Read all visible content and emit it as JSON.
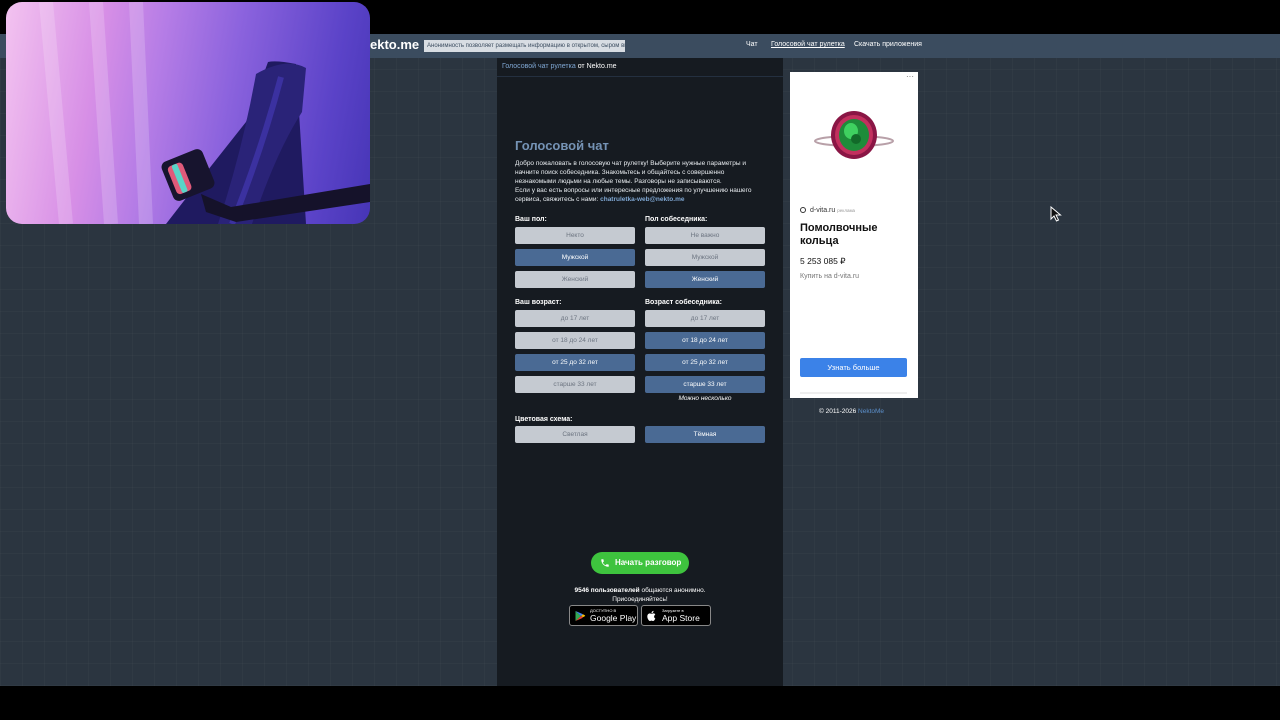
{
  "header": {
    "logo": "ekto.me",
    "notice": "Анонимность позволяет размещать информацию в открытом, сыром виде!",
    "nav": [
      {
        "label": "Чат",
        "active": false
      },
      {
        "label": "Голосовой чат рулетка",
        "active": true
      },
      {
        "label": "Скачать приложения",
        "active": false
      }
    ]
  },
  "breadcrumb": {
    "link": "Голосовой чат рулетка",
    "suffix": " от Nekto.me"
  },
  "main": {
    "title": "Голосовой чат",
    "intro_lines": [
      "Добро пожаловать в голосовую чат рулетку! Выберите нужные параметры и",
      "начните поиск собеседника. Знакомьтесь и общайтесь с совершенно",
      "незнакомыми людьми на любые темы. Разговоры не записываются.",
      "Если у вас есть вопросы или интересные предложения по улучшению нашего"
    ],
    "intro_last": "сервиса, свяжитесь с нами: ",
    "email": "chatruletka-web@nekto.me",
    "your_sex_label": "Ваш пол:",
    "partner_sex_label": "Пол собеседника:",
    "your_sex": [
      "Некто",
      "Мужской",
      "Женский"
    ],
    "partner_sex": [
      "Не важно",
      "Мужской",
      "Женский"
    ],
    "your_age_label": "Ваш возраст:",
    "partner_age_label": "Возраст собеседника:",
    "your_age": [
      "до 17 лет",
      "от 18 до 24 лет",
      "от 25 до 32 лет",
      "старше 33 лет"
    ],
    "partner_age": [
      "до 17 лет",
      "от 18 до 24 лет",
      "от 25 до 32 лет",
      "старше 33 лет"
    ],
    "multi_hint": "Можно несколько",
    "scheme_label": "Цветовая схема:",
    "scheme": [
      "Светлая",
      "Тёмная"
    ],
    "start_button": "Начать разговор",
    "users_count": "9546 пользователей",
    "users_text": " общаются анонимно.",
    "users_join": "Присоединяйтесь!",
    "google_small": "ДОСТУПНО В",
    "google_big": "Google Play",
    "apple_small": "Загрузите в",
    "apple_big": "App Store"
  },
  "ad": {
    "menu": "···",
    "domain": "d-vita.ru",
    "tag": "реклама",
    "title": "Помолвочные кольца",
    "price": "5 253 085 ₽",
    "buy": "Купить на d-vita.ru",
    "button": "Узнать больше"
  },
  "footer": {
    "copy": "© 2011-2026 ",
    "link": "NektoMe"
  },
  "colors": {
    "accent": "#4a6a94",
    "start": "#3ec33e",
    "ad_button": "#3b82e8"
  }
}
